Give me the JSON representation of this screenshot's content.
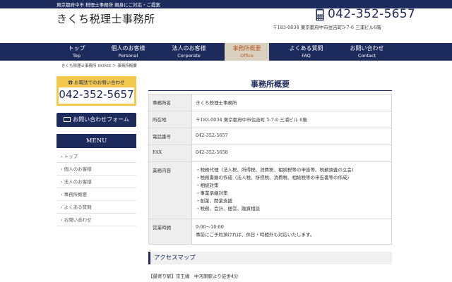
{
  "topbar": {
    "text": "東京都府中市 税理士事務所 親身にご対応・ご提案"
  },
  "header": {
    "logo": "きくち税理士事務所",
    "phone": "042-352-5657",
    "phone_icon": "phone-icon",
    "address": "〒183-0034 東京都府中市住吉町5-7-6 三浦ビル6階"
  },
  "nav": [
    {
      "jp": "トップ",
      "en": "Top"
    },
    {
      "jp": "個人のお客様",
      "en": "Personal"
    },
    {
      "jp": "法人のお客様",
      "en": "Corporate"
    },
    {
      "jp": "事務所概要",
      "en": "Office"
    },
    {
      "jp": "よくある質問",
      "en": "FAQ"
    },
    {
      "jp": "お問い合わせ",
      "en": "Contact"
    }
  ],
  "breadcrumb": "きくち税理士事務所 HOME ＞ 事務所概要",
  "sidebar": {
    "tel_head": "お電話でのお問い合わせ",
    "tel_num": "042-352-5657",
    "contact_btn": "お問い合わせフォーム",
    "menu_title": "MENU",
    "menu": [
      "トップ",
      "個人のお客様",
      "法人のお客様",
      "事務所概要",
      "よくある質問",
      "お問い合わせ"
    ]
  },
  "main": {
    "title": "事務所概要",
    "rows": {
      "name_label": "事務所名",
      "name": "きくち税理士事務所",
      "loc_label": "所在地",
      "loc": "〒183-0034 東京都府中市住吉町 5-7-6 三浦ビル 6階",
      "tel_label": "電話番号",
      "tel": "042-352-5657",
      "fax_label": "FAX",
      "fax": "042-352-5658",
      "biz_label": "業務内容",
      "biz": [
        "・税務代理（法人税、所得税、消費税、相続税等の申告等、税務調査の立会)",
        "・税務書類の作成（法人税、所得税、消費税、相続税等の申告書等の作成)",
        "・相続対策",
        "・事業承継対策",
        "・創業、開業支援",
        "・税務、会計、経営、融資相談"
      ],
      "hours_label": "営業時間",
      "hours": "9:00～18:00",
      "hours_note": "事前にご予約頂ければ、休日・時間外も対応いたします。"
    },
    "access_title": "アクセスマップ",
    "station": "【最寄り駅】京王線　中河原駅より徒歩4分"
  }
}
